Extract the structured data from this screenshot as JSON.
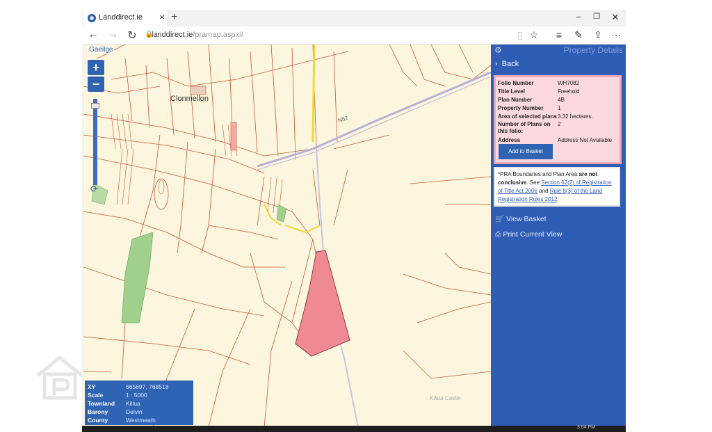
{
  "browser": {
    "tab_title": "Landdirect.ie",
    "tab_close": "×",
    "new_tab": "+",
    "minimize": "−",
    "restore": "❐",
    "close": "✕",
    "address_domain": "landdirect.ie",
    "address_path": "/pramap.aspx#"
  },
  "map": {
    "language_link": "Gaeilge",
    "zoom_in": "+",
    "zoom_out": "−",
    "place_label": "Clonmellon",
    "road_label": "N52",
    "field_note": "Killua\nCastle",
    "info": [
      {
        "key": "XY",
        "value": "665697, 768518"
      },
      {
        "key": "Scale",
        "value": "1 : 5000"
      },
      {
        "key": "Townland",
        "value": "Killua"
      },
      {
        "key": "Barony",
        "value": "Delvin"
      },
      {
        "key": "County",
        "value": "Westmeath"
      }
    ]
  },
  "panel": {
    "title": "Property Details",
    "back": "Back",
    "details": [
      {
        "key": "Folio Number",
        "value": "WH7082"
      },
      {
        "key": "Title Level",
        "value": "Freehold"
      },
      {
        "key": "Plan Number",
        "value": "4B"
      },
      {
        "key": "Property Number",
        "value": "1"
      },
      {
        "key": "Area of selected plans",
        "value": "3.32 hectares."
      },
      {
        "key": "Number of Plans on this folio:",
        "value": "2"
      },
      {
        "key": "Address",
        "value": "Address Not Available"
      }
    ],
    "add_to_basket": "Add to Basket",
    "note_prefix": "*PRA Boundaries and Plan Area ",
    "note_bold": "are not conclusive",
    "note_mid": ". See ",
    "note_link1": "Section 62(2) of Registration of Title Act 2006",
    "note_and": " and ",
    "note_link2": "Rule 8(3) of the Land Registration Rules 2012",
    "note_end": ".",
    "view_basket": "View Basket",
    "print_view": "Print Current View"
  },
  "taskbar": {
    "time": "3:54 PM"
  },
  "colors": {
    "panel": "#2f5cb4",
    "map_bg": "#fbf6dd",
    "selected_plot": "#f08a92",
    "boundary": "#c9573a"
  }
}
